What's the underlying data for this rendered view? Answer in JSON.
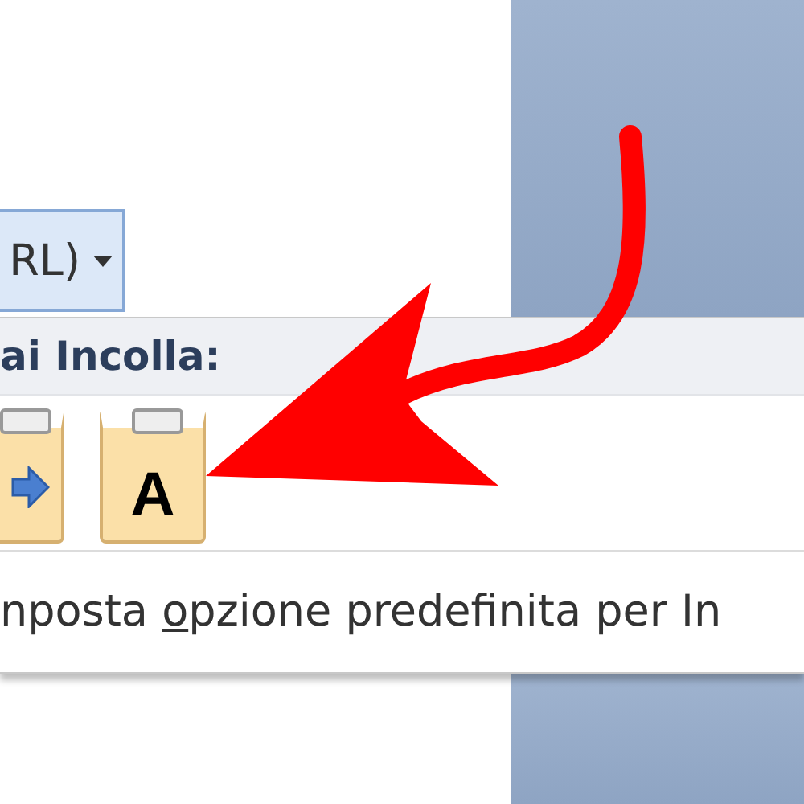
{
  "dropdown_button": {
    "label": "RL)"
  },
  "paste_menu": {
    "header": "ai Incolla:",
    "paste_options": [
      {
        "kind": "merge"
      },
      {
        "kind": "text",
        "letter": "A"
      }
    ],
    "default_item": {
      "before": "nposta ",
      "access_key": "o",
      "after": "pzione predefinita per In"
    }
  }
}
